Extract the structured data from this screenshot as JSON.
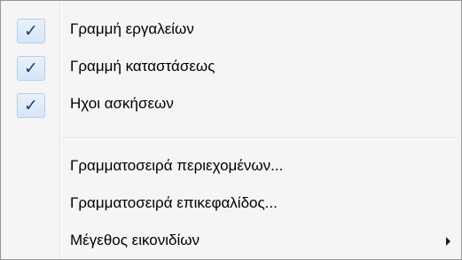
{
  "menu": {
    "items": [
      {
        "label": "Γραμμή εργαλείων",
        "checked": true,
        "icon": "check-icon"
      },
      {
        "label": "Γραμμή καταστάσεως",
        "checked": true,
        "icon": "check-icon"
      },
      {
        "label": "Ηχοι ασκήσεων",
        "checked": true,
        "icon": "check-icon"
      },
      {
        "label": "Γραμματοσειρά περιεχομένων...",
        "checked": false
      },
      {
        "label": "Γραμματοσειρά επικεφαλίδος...",
        "checked": false
      },
      {
        "label": "Μέγεθος εικονιδίων",
        "checked": false,
        "has_submenu": true,
        "icon": "submenu-arrow-icon"
      }
    ],
    "check_glyph": "✓"
  },
  "colors": {
    "menu_background": "#f5f5f5",
    "menu_border": "#979797",
    "check_box_background": "#dce9f8",
    "check_box_border": "#b8cde4",
    "check_color": "#1d3d72"
  }
}
